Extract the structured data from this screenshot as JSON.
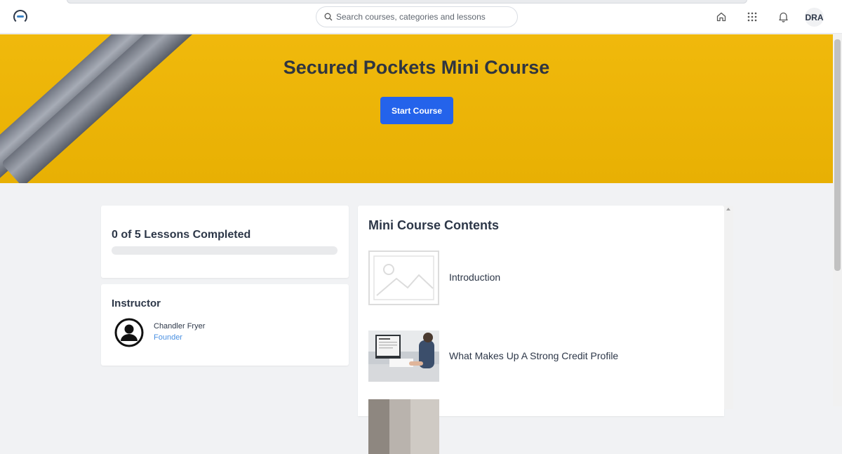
{
  "header": {
    "search_placeholder": "Search courses, categories and lessons",
    "avatar_initials": "DRA",
    "icons": [
      "logo-icon",
      "search-icon",
      "home-icon",
      "apps-grid-icon",
      "bell-icon"
    ]
  },
  "hero": {
    "title": "Secured Pockets Mini Course",
    "start_button": "Start Course",
    "background_color": "#f0b90c",
    "button_color": "#2463eb"
  },
  "progress": {
    "label": "0 of 5 Lessons Completed",
    "completed": 0,
    "total": 5
  },
  "instructor": {
    "heading": "Instructor",
    "name": "Chandler Fryer",
    "role": "Founder"
  },
  "contents": {
    "heading": "Mini Course Contents",
    "lessons": [
      {
        "title": "Introduction",
        "thumbnail": "placeholder-image-icon"
      },
      {
        "title": "What Makes Up A Strong Credit Profile",
        "thumbnail": "credit-report-photo"
      },
      {
        "title": "",
        "thumbnail": "photo"
      }
    ]
  }
}
